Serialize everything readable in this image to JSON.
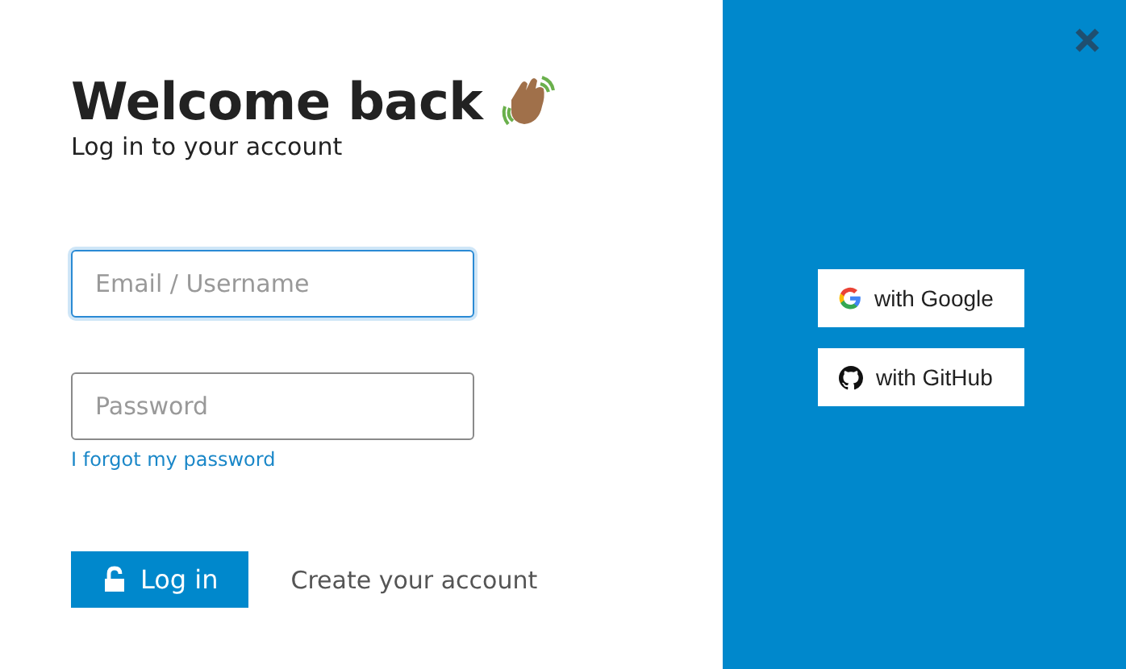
{
  "login": {
    "title": "Welcome back",
    "subtitle": "Log in to your account",
    "fields": [
      {
        "placeholder": "Email / Username",
        "focused": true
      },
      {
        "placeholder": "Password",
        "focused": false
      }
    ],
    "forgot_link": "I forgot my password",
    "login_button": "Log in",
    "create_account_link": "Create your account"
  },
  "social": {
    "buttons": [
      {
        "kind": "google",
        "label": "with Google"
      },
      {
        "kind": "github",
        "label": "with GitHub"
      }
    ]
  }
}
